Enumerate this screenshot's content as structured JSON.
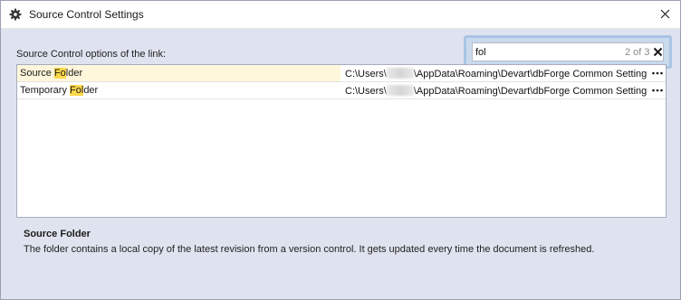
{
  "window": {
    "title": "Source Control Settings",
    "title_icon": "gear-icon",
    "close_icon": "close-icon"
  },
  "options_label": "Source Control options of the link:",
  "search": {
    "value": "fol",
    "match_count": "2 of 3",
    "clear_icon": "close-icon"
  },
  "rows": [
    {
      "name_pre": "Source ",
      "name_hl": "Fo",
      "name_post": "lder",
      "value_pre": "C:\\Users\\",
      "value_post": "\\AppData\\Roaming\\Devart\\dbForge Common Setting...",
      "selected": true
    },
    {
      "name_pre": "Temporary ",
      "name_hl": "Fol",
      "name_post": "der",
      "value_pre": "C:\\Users\\",
      "value_post": "\\AppData\\Roaming\\Devart\\dbForge Common Setting...",
      "selected": false
    }
  ],
  "description": {
    "title": "Source Folder",
    "text": "The folder contains a local copy of the latest revision from a version control. It gets updated every time the document is refreshed."
  },
  "colors": {
    "highlight": "#ffd84a",
    "selected_row": "#fff7dc",
    "dialog_background": "#dfe3ef"
  }
}
